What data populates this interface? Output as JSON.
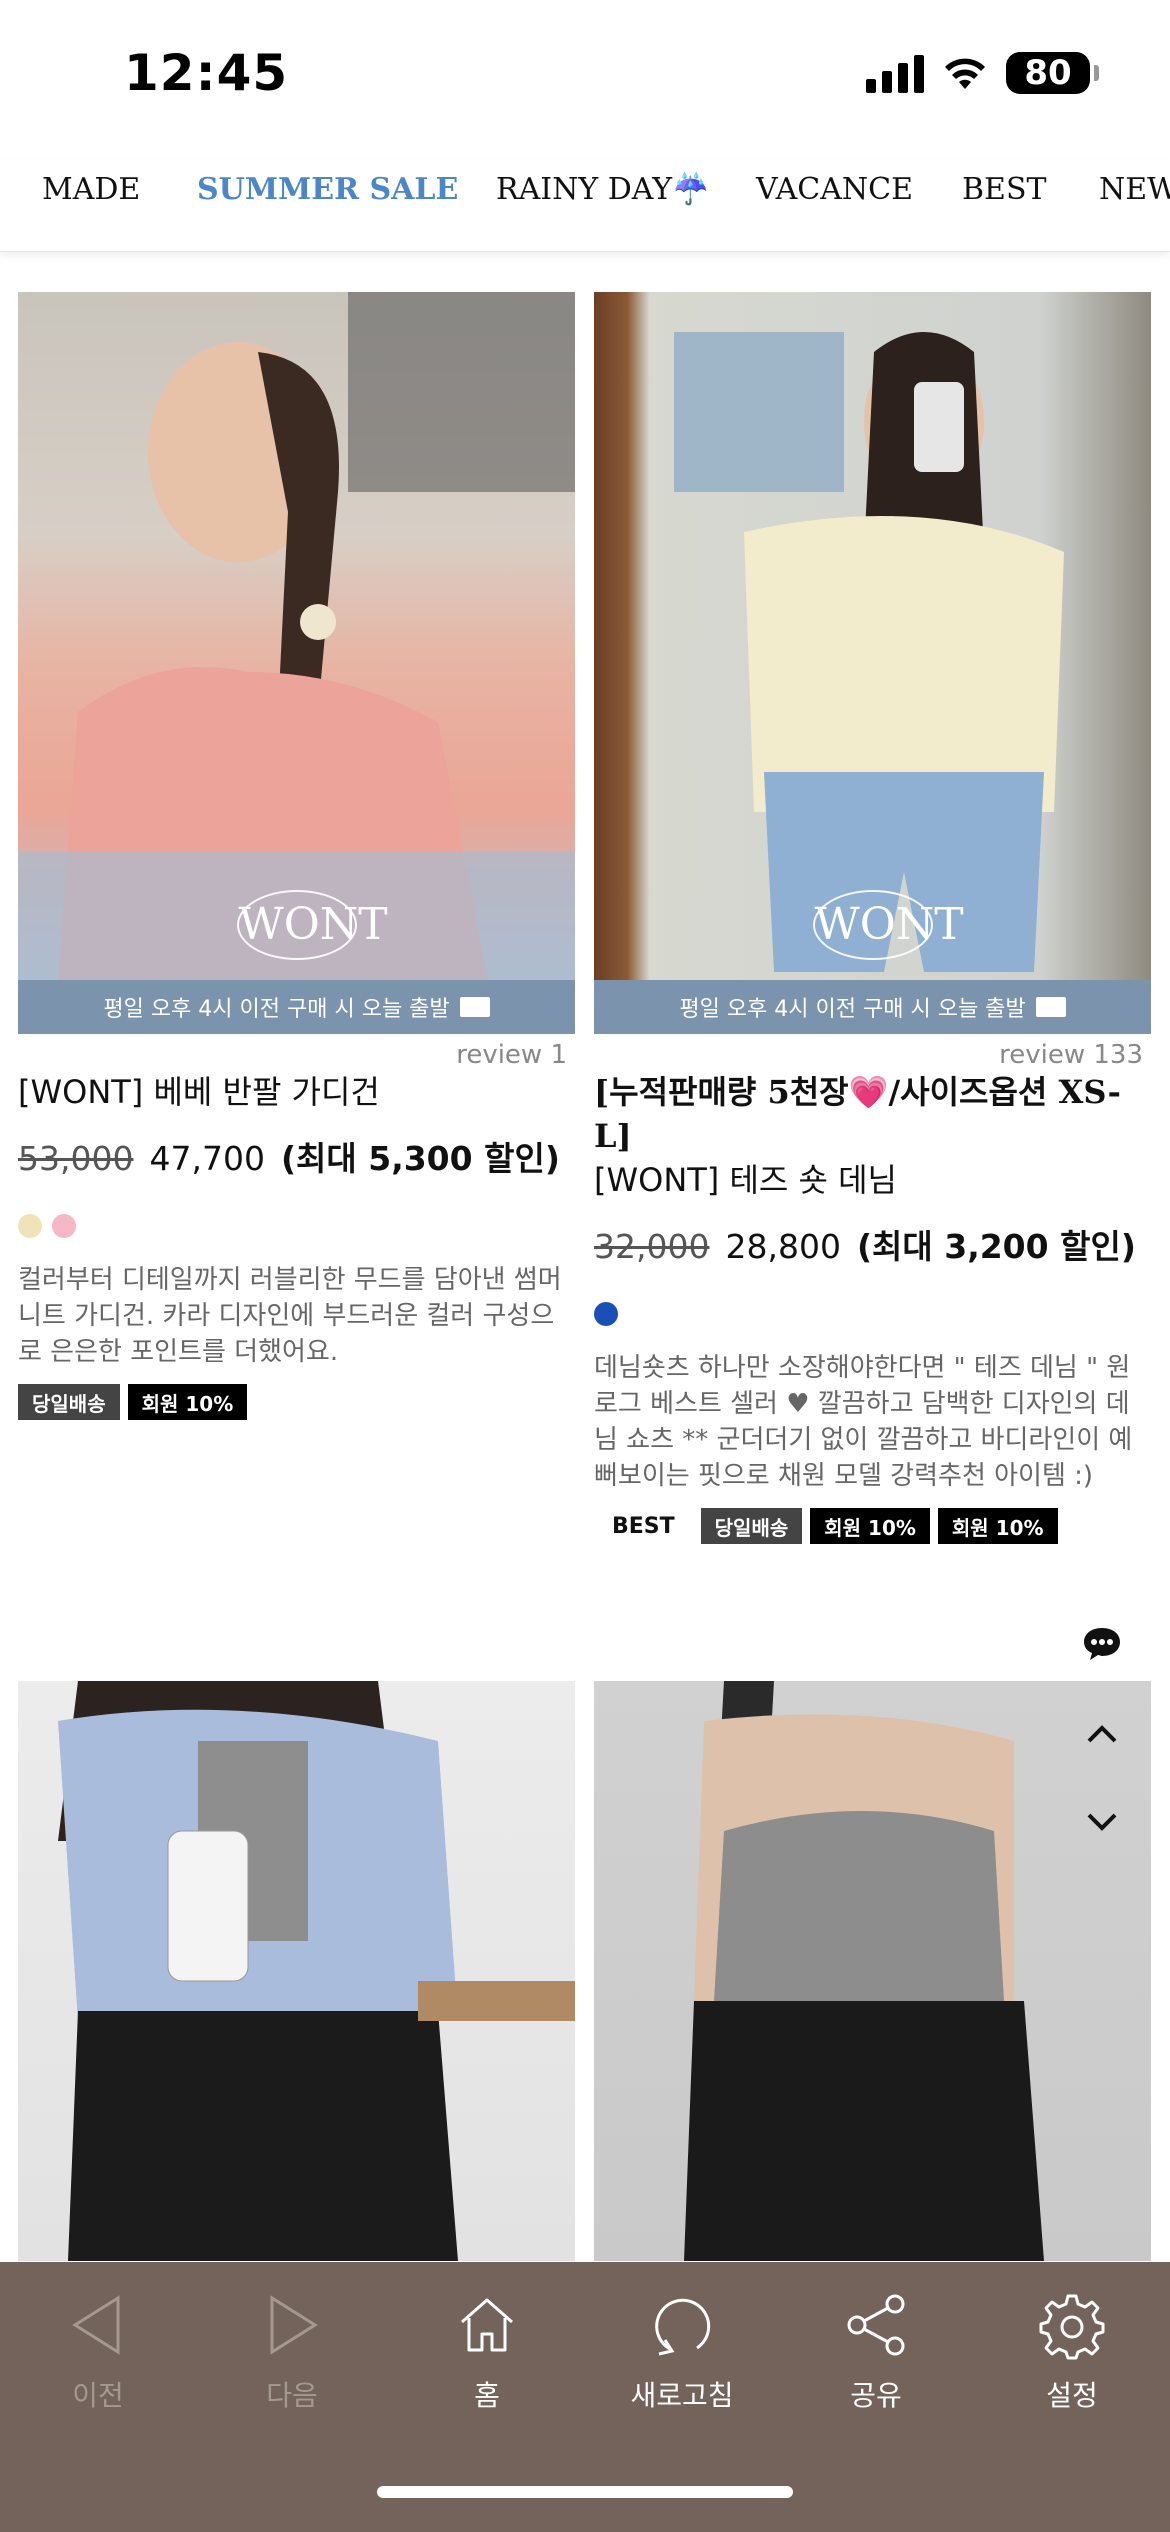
{
  "status_bar": {
    "time": "12:45",
    "battery": "80"
  },
  "nav": {
    "items": [
      "MADE",
      "SUMMER SALE",
      "RAINY DAY",
      "VACANCE",
      "BEST",
      "NEW"
    ],
    "active_index": 1,
    "accent_color": "#4a86c8"
  },
  "products": [
    {
      "shipping_banner": "평일 오후 4시 이전 구매 시 오늘 출발",
      "review": "review 1",
      "headline": "",
      "title": "[WONT] 베베 반팔 가디건",
      "old_price": "53,000",
      "price": "47,700",
      "discount": "(최대 5,300 할인)",
      "swatches": [
        "#f1e3b9",
        "#f5b9c6"
      ],
      "description": "컬러부터 디테일까지 러블리한 무드를 담아낸 썸머 니트 가디건. 카라 디자인에 부드러운 컬러 구성으로 은은한 포인트를 더했어요.",
      "badges": [
        "당일배송",
        "회원 10%"
      ]
    },
    {
      "shipping_banner": "평일 오후 4시 이전 구매 시 오늘 출발",
      "review": "review 133",
      "headline": "[누적판매량 5천장💗/사이즈옵션 XS-L]",
      "title": "[WONT] 테즈 숏 데님",
      "old_price": "32,000",
      "price": "28,800",
      "discount": "(최대 3,200 할인)",
      "swatches": [
        "#1a4fb8"
      ],
      "description": "데님숏츠 하나만 소장해야한다면 \" 테즈 데님 \" 원로그 베스트 셀러 ♥ 깔끔하고 담백한 디자인의 데님 쇼츠 ** 군더더기 없이 깔끔하고 바디라인이 예뻐보이는 핏으로 채원 모델 강력추천 아이템 :)",
      "badges": [
        "BEST",
        "당일배송",
        "회원 10%",
        "회원 10%"
      ]
    }
  ],
  "watermark": "WONT",
  "toolbar": {
    "items": [
      {
        "label": "이전",
        "icon": "back-triangle-icon",
        "enabled": false
      },
      {
        "label": "다음",
        "icon": "forward-triangle-icon",
        "enabled": false
      },
      {
        "label": "홈",
        "icon": "home-icon",
        "enabled": true
      },
      {
        "label": "새로고침",
        "icon": "refresh-icon",
        "enabled": true
      },
      {
        "label": "공유",
        "icon": "share-icon",
        "enabled": true
      },
      {
        "label": "설정",
        "icon": "gear-icon",
        "enabled": true
      }
    ],
    "background": "#73635a"
  }
}
